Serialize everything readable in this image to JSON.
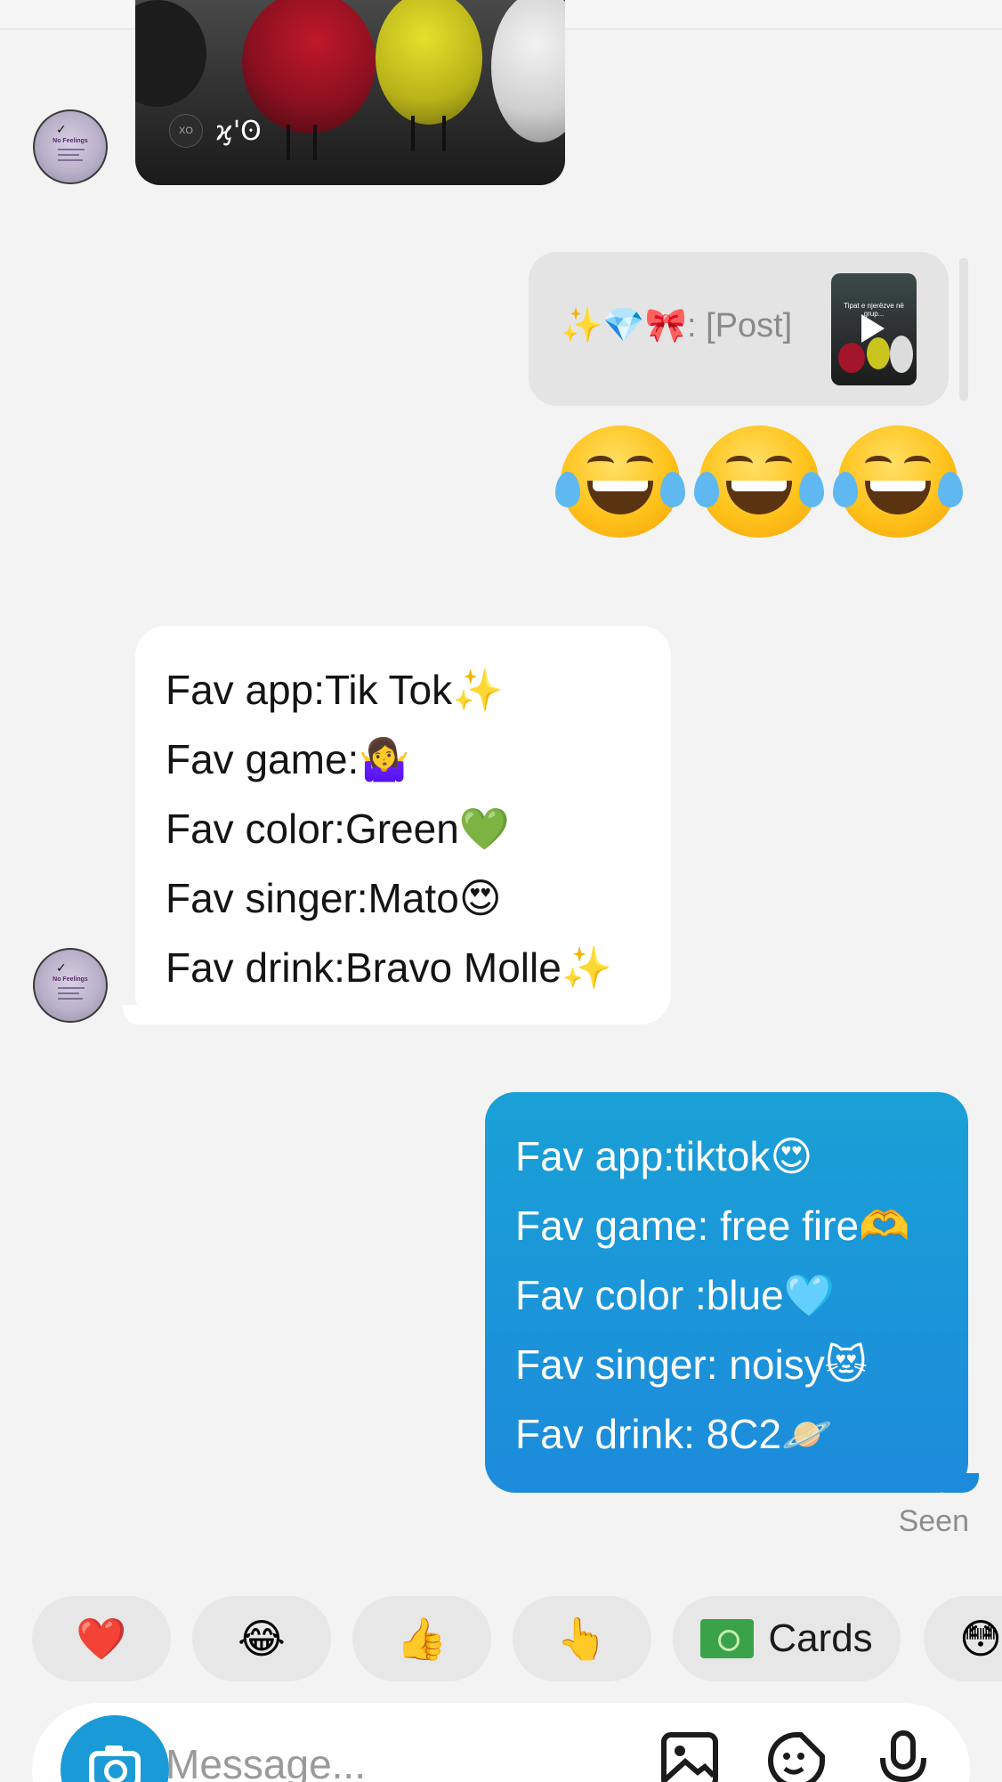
{
  "video_share": {
    "handle_text": "ϗ'ʘ",
    "handle_icon": "xo-icon"
  },
  "shared_post": {
    "label_emoji": "✨💎🎀",
    "label_text": ": [Post]",
    "thumb_caption": "Tipat e njerëzve në grup..."
  },
  "reaction_emojis": [
    "😂",
    "😂",
    "😂"
  ],
  "incoming_message": {
    "lines": [
      {
        "text": "Fav app:Tik Tok",
        "emoji": "✨"
      },
      {
        "text": "Fav game:",
        "emoji": "🤷‍♀️"
      },
      {
        "text": "Fav color:Green",
        "emoji": "💚"
      },
      {
        "text": "Fav singer:Mato",
        "emoji": "😍"
      },
      {
        "text": "Fav drink:Bravo Molle",
        "emoji": "✨"
      }
    ]
  },
  "outgoing_message": {
    "lines": [
      {
        "text": "Fav app:tiktok",
        "emoji": "😍"
      },
      {
        "text": "Fav game: free fire",
        "emoji": "🫶"
      },
      {
        "text": "Fav color :blue",
        "emoji": "🩵"
      },
      {
        "text": "Fav singer: noisy",
        "emoji": "😻"
      },
      {
        "text": "Fav drink: 8C2",
        "emoji": "🪐"
      }
    ],
    "status": "Seen"
  },
  "quick_reactions": [
    {
      "emoji": "❤️",
      "name": "heart"
    },
    {
      "emoji": "😂",
      "name": "laughing"
    },
    {
      "emoji": "👍",
      "name": "thumbs-up"
    },
    {
      "emoji": "👆",
      "name": "pointing"
    },
    {
      "label": "Cards",
      "name": "cards"
    },
    {
      "emoji": "😳",
      "name": "more"
    }
  ],
  "composer": {
    "placeholder": "Message...",
    "icons": [
      "camera-icon",
      "image-icon",
      "sticker-icon",
      "microphone-icon"
    ]
  },
  "colors": {
    "outgoing_bubble": "#1c8bdb",
    "incoming_bubble": "#ffffff",
    "background": "#f3f3f3",
    "camera_button": "#1a9bd7"
  }
}
